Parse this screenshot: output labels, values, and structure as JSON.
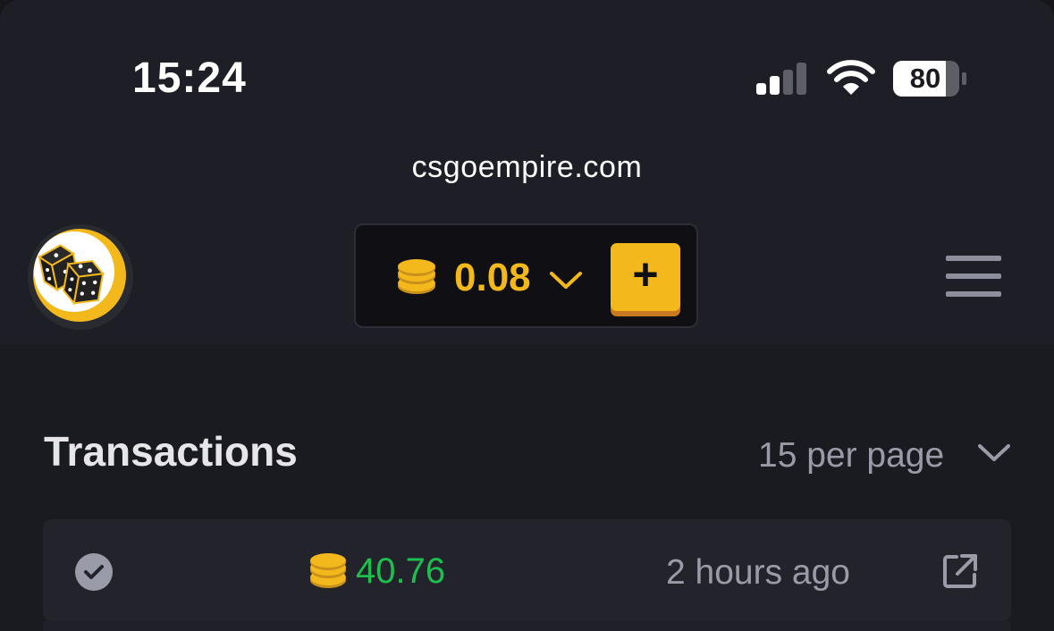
{
  "status_bar": {
    "time": "15:24",
    "battery_level": "80",
    "icons": [
      "signal-icon",
      "wifi-icon",
      "battery-icon"
    ]
  },
  "browser": {
    "url": "csgoempire.com"
  },
  "header": {
    "logo_icon": "dice-logo-icon",
    "balance": "0.08",
    "balance_icon": "coins-icon",
    "deposit_label": "+",
    "menu_icon": "hamburger-menu-icon"
  },
  "transactions": {
    "title": "Transactions",
    "per_page_label": "15 per page",
    "rows": [
      {
        "status_icon": "check-circle-icon",
        "amount": "40.76",
        "time": "2 hours ago",
        "link_icon": "external-link-icon"
      }
    ]
  },
  "colors": {
    "accent": "#f2b81c",
    "positive": "#1fbf4f",
    "muted_text": "#9a9ba8",
    "background": "#1a1b21",
    "header_background": "#1e1f26"
  }
}
